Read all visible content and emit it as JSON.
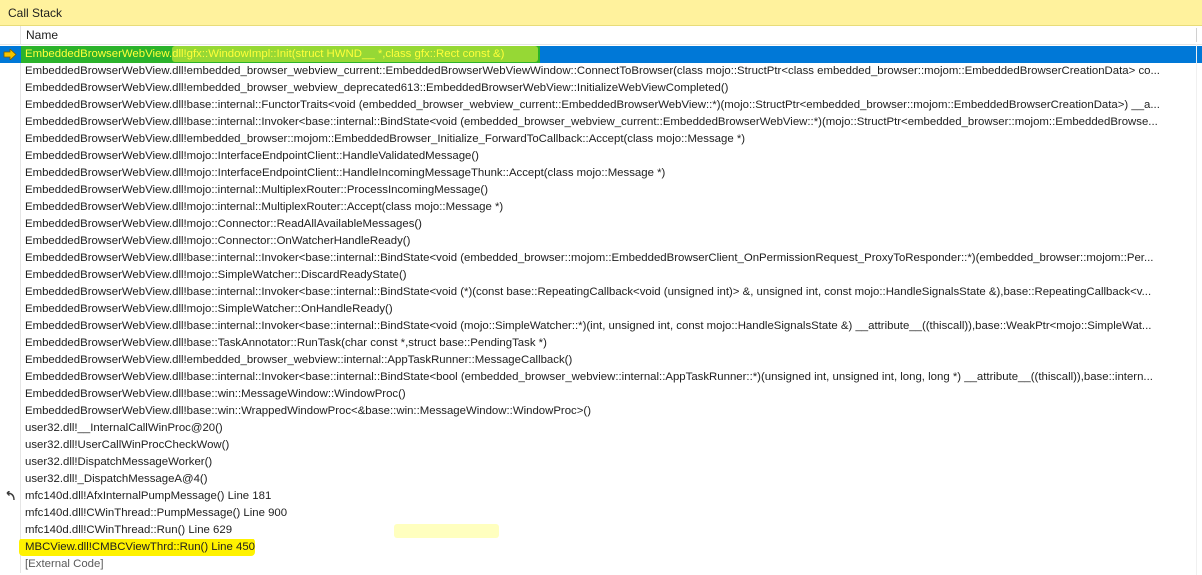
{
  "panel": {
    "title": "Call Stack"
  },
  "columns": {
    "name": "Name"
  },
  "rows": [
    {
      "text": "EmbeddedBrowserWebView.dll!gfx::WindowImpl::Init(struct HWND__ *,class gfx::Rect const &)",
      "state": "selected",
      "icon": "current-frame-arrow-icon"
    },
    {
      "text": "EmbeddedBrowserWebView.dll!embedded_browser_webview_current::EmbeddedBrowserWebViewWindow::ConnectToBrowser(class mojo::StructPtr<class embedded_browser::mojom::EmbeddedBrowserCreationData> co..."
    },
    {
      "text": "EmbeddedBrowserWebView.dll!embedded_browser_webview_deprecated613::EmbeddedBrowserWebView::InitializeWebViewCompleted()"
    },
    {
      "text": "EmbeddedBrowserWebView.dll!base::internal::FunctorTraits<void (embedded_browser_webview_current::EmbeddedBrowserWebView::*)(mojo::StructPtr<embedded_browser::mojom::EmbeddedBrowserCreationData>) __a..."
    },
    {
      "text": "EmbeddedBrowserWebView.dll!base::internal::Invoker<base::internal::BindState<void (embedded_browser_webview_current::EmbeddedBrowserWebView::*)(mojo::StructPtr<embedded_browser::mojom::EmbeddedBrowse..."
    },
    {
      "text": "EmbeddedBrowserWebView.dll!embedded_browser::mojom::EmbeddedBrowser_Initialize_ForwardToCallback::Accept(class mojo::Message *)"
    },
    {
      "text": "EmbeddedBrowserWebView.dll!mojo::InterfaceEndpointClient::HandleValidatedMessage()"
    },
    {
      "text": "EmbeddedBrowserWebView.dll!mojo::InterfaceEndpointClient::HandleIncomingMessageThunk::Accept(class mojo::Message *)"
    },
    {
      "text": "EmbeddedBrowserWebView.dll!mojo::internal::MultiplexRouter::ProcessIncomingMessage()"
    },
    {
      "text": "EmbeddedBrowserWebView.dll!mojo::internal::MultiplexRouter::Accept(class mojo::Message *)"
    },
    {
      "text": "EmbeddedBrowserWebView.dll!mojo::Connector::ReadAllAvailableMessages()"
    },
    {
      "text": "EmbeddedBrowserWebView.dll!mojo::Connector::OnWatcherHandleReady()"
    },
    {
      "text": "EmbeddedBrowserWebView.dll!base::internal::Invoker<base::internal::BindState<void (embedded_browser::mojom::EmbeddedBrowserClient_OnPermissionRequest_ProxyToResponder::*)(embedded_browser::mojom::Per..."
    },
    {
      "text": "EmbeddedBrowserWebView.dll!mojo::SimpleWatcher::DiscardReadyState()"
    },
    {
      "text": "EmbeddedBrowserWebView.dll!base::internal::Invoker<base::internal::BindState<void (*)(const base::RepeatingCallback<void (unsigned int)> &, unsigned int, const mojo::HandleSignalsState &),base::RepeatingCallback<v..."
    },
    {
      "text": "EmbeddedBrowserWebView.dll!mojo::SimpleWatcher::OnHandleReady()"
    },
    {
      "text": "EmbeddedBrowserWebView.dll!base::internal::Invoker<base::internal::BindState<void (mojo::SimpleWatcher::*)(int, unsigned int, const mojo::HandleSignalsState &) __attribute__((thiscall)),base::WeakPtr<mojo::SimpleWat..."
    },
    {
      "text": "EmbeddedBrowserWebView.dll!base::TaskAnnotator::RunTask(char const *,struct base::PendingTask *)"
    },
    {
      "text": "EmbeddedBrowserWebView.dll!embedded_browser_webview::internal::AppTaskRunner::MessageCallback()"
    },
    {
      "text": "EmbeddedBrowserWebView.dll!base::internal::Invoker<base::internal::BindState<bool (embedded_browser_webview::internal::AppTaskRunner::*)(unsigned int, unsigned int, long, long *) __attribute__((thiscall)),base::intern..."
    },
    {
      "text": "EmbeddedBrowserWebView.dll!base::win::MessageWindow::WindowProc()"
    },
    {
      "text": "EmbeddedBrowserWebView.dll!base::win::WrappedWindowProc<&base::win::MessageWindow::WindowProc>()"
    },
    {
      "text": "user32.dll!__InternalCallWinProc@20()"
    },
    {
      "text": "user32.dll!UserCallWinProcCheckWow()"
    },
    {
      "text": "user32.dll!DispatchMessageWorker()"
    },
    {
      "text": "user32.dll!_DispatchMessageA@4()"
    },
    {
      "text": "mfc140d.dll!AfxInternalPumpMessage() Line 181",
      "icon": "return-arrow-icon"
    },
    {
      "text": "mfc140d.dll!CWinThread::PumpMessage() Line 900"
    },
    {
      "text": "mfc140d.dll!CWinThread::Run() Line 629",
      "state": "highlight3"
    },
    {
      "text": "MBCView.dll!CMBCViewThrd::Run() Line 450",
      "state": "highlight2"
    },
    {
      "text": "[External Code]",
      "state": "external"
    }
  ],
  "colors": {
    "title_bg": "#fff29d",
    "selection": "#0078d7",
    "selection_highlight": "#2bb32b",
    "marker_yellow": "#fff200"
  }
}
